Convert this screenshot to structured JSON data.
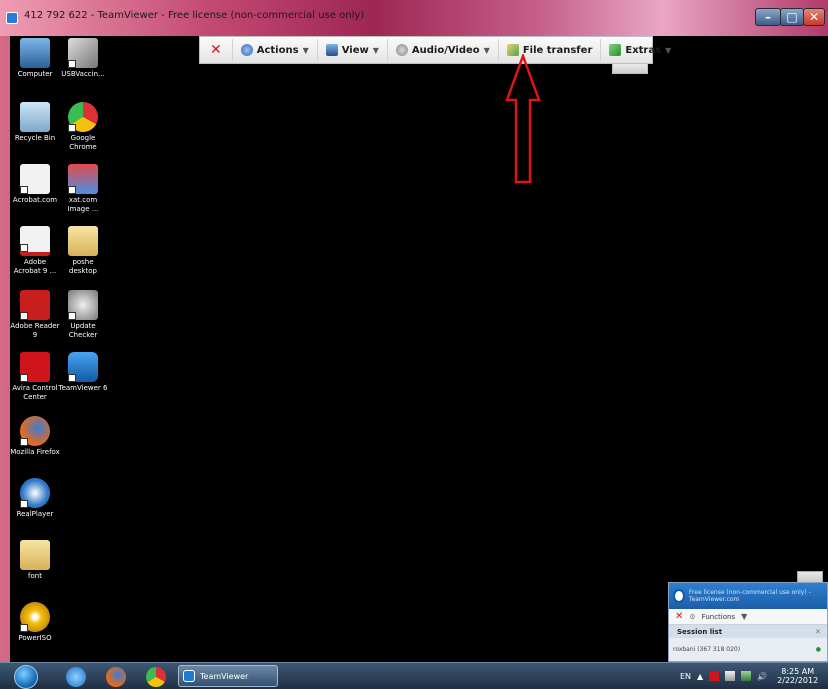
{
  "window": {
    "title": "412 792 622 - TeamViewer - Free license (non-commercial use only)"
  },
  "toolbar": {
    "items": [
      {
        "label": "Actions",
        "icon": "gear-icon"
      },
      {
        "label": "View",
        "icon": "monitor-icon"
      },
      {
        "label": "Audio/Video",
        "icon": "audio-video-icon"
      },
      {
        "label": "File transfer",
        "icon": "file-transfer-icon"
      },
      {
        "label": "Extras",
        "icon": "puzzle-icon"
      }
    ]
  },
  "desktop_icons": [
    {
      "label": "Computer",
      "icon": "computer-icon"
    },
    {
      "label": "USBVaccin...",
      "icon": "syringe-icon"
    },
    {
      "label": "Recycle Bin",
      "icon": "recycle-bin-icon"
    },
    {
      "label": "Google Chrome",
      "icon": "chrome-icon"
    },
    {
      "label": "Acrobat.com",
      "icon": "acrobat-icon"
    },
    {
      "label": "xat.com Image ...",
      "icon": "xat-icon"
    },
    {
      "label": "Adobe Acrobat 9 ...",
      "icon": "acrobat9-icon"
    },
    {
      "label": "poshe desktop",
      "icon": "folder-icon"
    },
    {
      "label": "Adobe Reader 9",
      "icon": "adobe-reader-icon"
    },
    {
      "label": "Update Checker",
      "icon": "update-checker-icon"
    },
    {
      "label": "Avira Control Center",
      "icon": "avira-icon"
    },
    {
      "label": "TeamViewer 6",
      "icon": "teamviewer-icon"
    },
    {
      "label": "Mozilla Firefox",
      "icon": "firefox-icon"
    },
    {
      "label": "RealPlayer",
      "icon": "realplayer-icon"
    },
    {
      "label": "font",
      "icon": "folder-icon"
    },
    {
      "label": "PowerISO",
      "icon": "poweriso-icon"
    }
  ],
  "taskbar": {
    "active_task": "TeamViewer",
    "language": "EN",
    "time": "8:25 AM",
    "date": "2/22/2012"
  },
  "tv_panel": {
    "license": "Free license (non-commercial use only) - TeamViewer.com",
    "functions_label": "Functions",
    "session_list_label": "Session list",
    "session_entry": "roxbani (367 318 020)"
  },
  "colors": {
    "annotation_arrow": "#e01414",
    "desktop_bg": "#000000",
    "close_x": "#d11b1b"
  }
}
